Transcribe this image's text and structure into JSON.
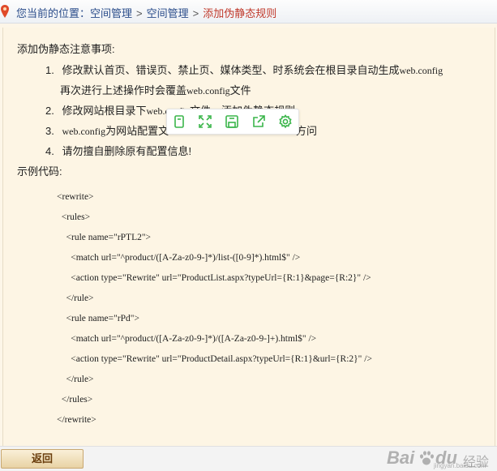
{
  "breadcrumb": {
    "prefix": "您当前的位置：",
    "items": [
      "空间管理",
      "空间管理"
    ],
    "separator": ">",
    "current": "添加伪静态规则"
  },
  "notes": {
    "heading": "添加伪静态注意事项:",
    "items": [
      {
        "num": "1.",
        "cn": "修改默认首页、错误页、禁止页、媒体类型、时系统会在根目录自动生成",
        "mono": "web.config"
      },
      {
        "num": "",
        "cn": "再次进行上述操作时会覆盖",
        "mono": "web.config",
        "cn2": "文件"
      },
      {
        "num": "2.",
        "cn": "修改网站根目录下",
        "mono": "web.config",
        "cn2": "文件，添加伪静态规则"
      },
      {
        "num": "3.",
        "cn": "",
        "mono": "web.config",
        "cn2": "为网站配置文",
        "cn3": "方问"
      },
      {
        "num": "4.",
        "cn": "请勿擅自删除原有配置信息!"
      }
    ]
  },
  "example": {
    "label": "示例代码:",
    "lines": [
      "<rewrite>",
      "  <rules>",
      "    <rule name=\"rPTL2\">",
      "      <match url=\"^product/([A-Za-z0-9-]*)/list-([0-9]*).html$\" />",
      "      <action type=\"Rewrite\" url=\"ProductList.aspx?typeUrl={R:1}&page={R:2}\" />",
      "    </rule>",
      "    <rule name=\"rPd\">",
      "      <match url=\"^product/([A-Za-z0-9-]*)/([A-Za-z0-9-]+).html$\" />",
      "      <action type=\"Rewrite\" url=\"ProductDetail.aspx?typeUrl={R:1}&url={R:2}\" />",
      "    </rule>",
      "  </rules>",
      "</rewrite>"
    ]
  },
  "toolbar": {
    "buttons": [
      "copy-icon",
      "expand-icon",
      "save-icon",
      "share-icon",
      "settings-icon"
    ],
    "color": "#3ab54a"
  },
  "footer": {
    "back_label": "返回"
  },
  "watermark": {
    "bai": "Bai",
    "du": "du",
    "jingyan": "经验",
    "url": "jingyan.baidu.com"
  }
}
